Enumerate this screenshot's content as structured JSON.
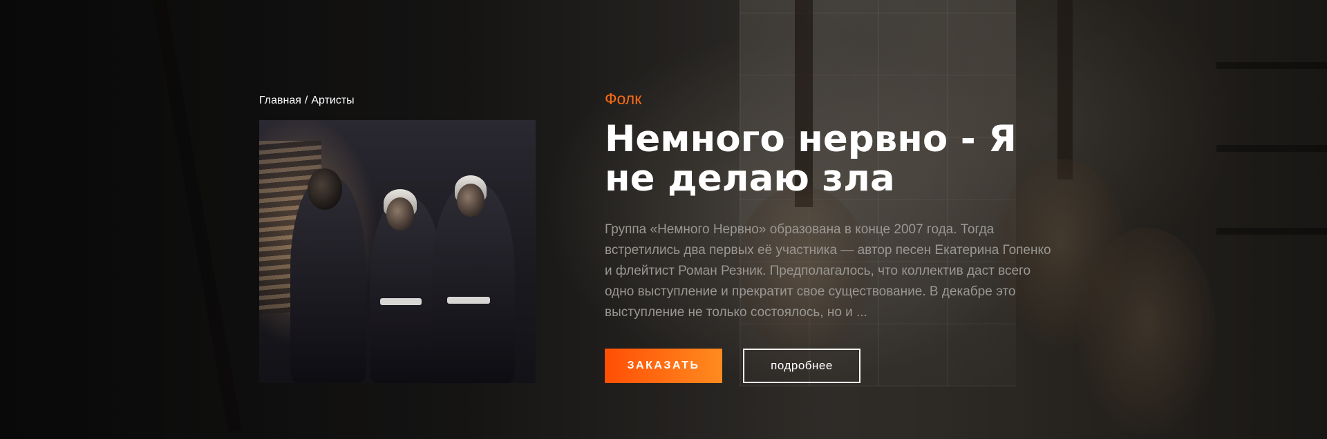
{
  "breadcrumb": {
    "home": "Главная",
    "separator": "/",
    "current": "Артисты"
  },
  "artist": {
    "genre": "Фолк",
    "title": "Немного нервно - Я не делаю зла",
    "description": "Группа «Немного Нервно» образована в конце 2007 года. Тогда встретились два первых её участника — автор песен Екатерина Гопенко и флейтист Роман Резник. Предполагалось, что коллектив даст всего одно выступление и прекратит свое существование. В декабре это выступление не только состоялось, но и ..."
  },
  "buttons": {
    "order": "ЗАКАЗАТЬ",
    "more": "подробнее"
  },
  "colors": {
    "accent": "#ff6a13",
    "button_gradient_start": "#ff4f05",
    "button_gradient_end": "#ff8b20",
    "description_text": "#9a9793"
  }
}
